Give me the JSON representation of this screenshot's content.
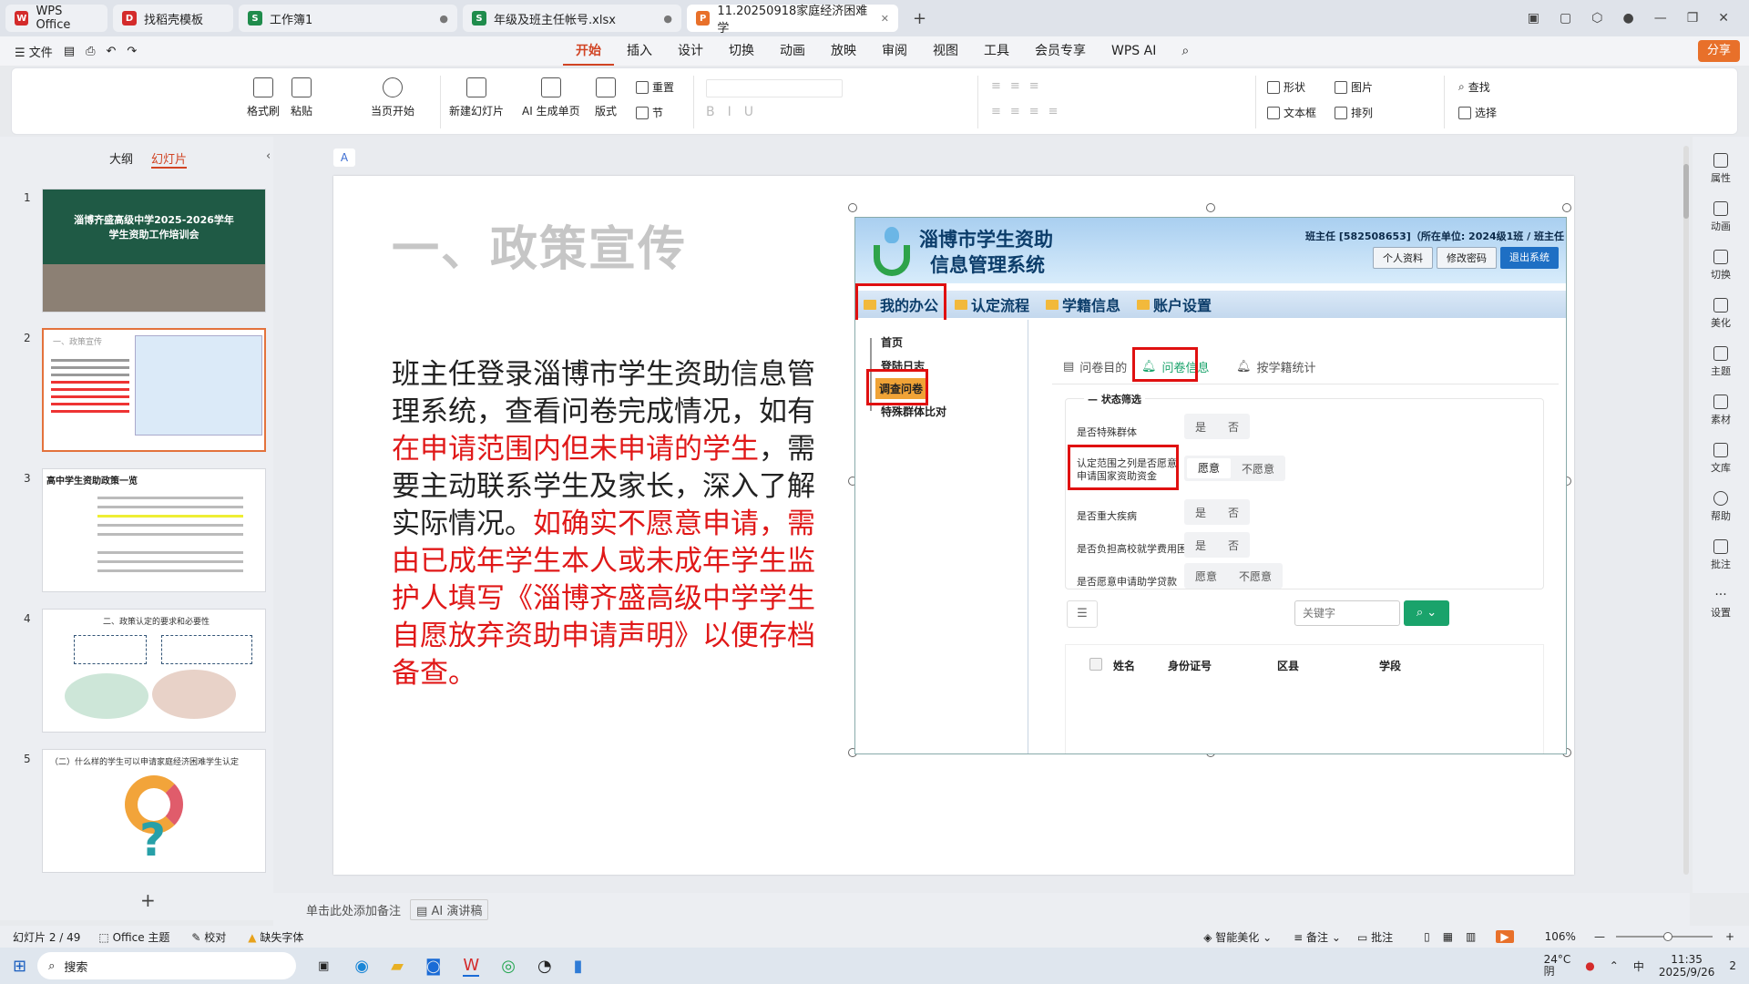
{
  "tabs": [
    {
      "label": "WPS Office",
      "color": "#d42b2b",
      "glyph": "W"
    },
    {
      "label": "找稻壳模板",
      "color": "#d42b2b",
      "glyph": "D"
    },
    {
      "label": "工作簿1",
      "color": "#1f8c4c",
      "glyph": "S"
    },
    {
      "label": "年级及班主任帐号.xlsx",
      "color": "#1f8c4c",
      "glyph": "S"
    },
    {
      "label": "11.20250918家庭经济困难学",
      "color": "#e8702a",
      "glyph": "P"
    }
  ],
  "menu": {
    "file": "文件",
    "tabs": [
      "开始",
      "插入",
      "设计",
      "切换",
      "动画",
      "放映",
      "审阅",
      "视图",
      "工具",
      "会员专享",
      "WPS AI"
    ],
    "active": "开始",
    "share": "分享"
  },
  "ribbon": {
    "format_painter": "格式刷",
    "paste": "粘贴",
    "start_from_current": "当页开始",
    "new_slide": "新建幻灯片",
    "ai_single": "AI 生成单页",
    "layout": "版式",
    "reset": "重置",
    "section": "节",
    "shape": "形状",
    "picture": "图片",
    "textbox": "文本框",
    "arrange": "排列",
    "find": "查找",
    "select": "选择"
  },
  "left_panel": {
    "outline": "大纲",
    "slides": "幻灯片",
    "add": "+",
    "thumbs": [
      {
        "num": "1",
        "title": "淄博齐盛高级中学2025-2026学年\n学生资助工作培训会"
      },
      {
        "num": "2",
        "title": "一、政策宣传"
      },
      {
        "num": "3",
        "title": "高中学生资助政策一览"
      },
      {
        "num": "4",
        "title": "二、政策认定的要求和必要性"
      },
      {
        "num": "5",
        "title": "（二）什么样的学生可以申请家庭经济困难学生认定"
      }
    ]
  },
  "slide": {
    "title": "一、政策宣传",
    "body_black_1": "班主任登录淄博市学生资助信息管理系统，查看问卷完成情况，如有",
    "body_red_1": "在申请范围内但未申请的学生",
    "body_black_2": "，需要主动联系学生及家长，深入了解实际情况。",
    "body_red_2": "如确实不愿意申请，需由已成年学生本人或未成年学生监护人填写《淄博齐盛高级中学学生自愿放弃资助申请声明》以便存档备查。",
    "system": {
      "title_line1": "淄博市学生资助",
      "title_line2": "信息管理系统",
      "user_info": "班主任 [582508653]（所在单位: 2024级1班 / 班主任",
      "buttons": [
        "个人资料",
        "修改密码",
        "退出系统"
      ],
      "nav": [
        "我的办公",
        "认定流程",
        "学籍信息",
        "账户设置"
      ],
      "side": [
        "首页",
        "登陆日志",
        "调查问卷",
        "特殊群体比对"
      ],
      "qtabs": [
        "问卷目的",
        "问卷信息",
        "按学籍统计"
      ],
      "filter_title": "状态筛选",
      "filters": [
        {
          "label": "是否特殊群体",
          "opts": [
            "是",
            "否"
          ]
        },
        {
          "label": "认定范围之列是否愿意申请国家资助资金",
          "opts": [
            "愿意",
            "不愿意"
          ]
        },
        {
          "label": "是否重大疾病",
          "opts": [
            "是",
            "否"
          ]
        },
        {
          "label": "是否负担高校就学费用困难",
          "opts": [
            "是",
            "否"
          ]
        },
        {
          "label": "是否愿意申请助学贷款",
          "opts": [
            "愿意",
            "不愿意"
          ]
        }
      ],
      "keyword_placeholder": "关键字",
      "columns": [
        "姓名",
        "身份证号",
        "区县",
        "学段"
      ]
    }
  },
  "notes_placeholder": "单击此处添加备注",
  "ai_speech": "AI 演讲稿",
  "status": {
    "slide": "幻灯片 2 / 49",
    "theme": "Office 主题",
    "proof": "校对",
    "missing_font": "缺失字体",
    "beautify": "智能美化",
    "notes": "备注",
    "comment": "批注",
    "zoom": "106%"
  },
  "right_tools": [
    "属性",
    "动画",
    "切换",
    "美化",
    "主题",
    "素材",
    "文库",
    "帮助",
    "批注",
    "设置"
  ],
  "taskbar": {
    "search": "搜索",
    "weather": "24°C",
    "weather_sub": "阴",
    "ime": "中",
    "time": "11:35",
    "date": "2025/9/26",
    "notify": "2"
  }
}
